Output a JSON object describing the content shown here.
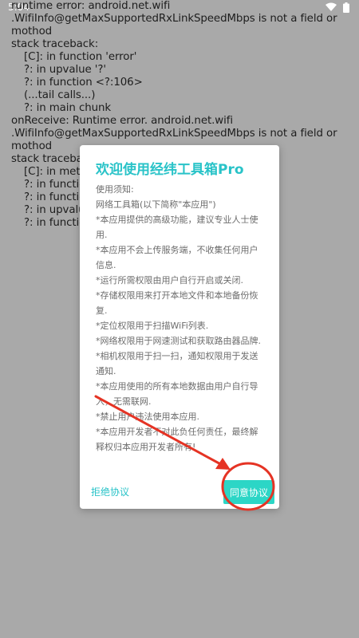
{
  "status_bar": {
    "time": "5:04"
  },
  "log_lines": [
    {
      "text": "runtime error: android.net.wifi",
      "indent": false
    },
    {
      "text": ".WifiInfo@getMaxSupportedRxLinkSpeedMbps is not a field or",
      "indent": false
    },
    {
      "text": "mothod",
      "indent": false
    },
    {
      "text": "stack traceback:",
      "indent": false
    },
    {
      "text": "[C]: in function 'error'",
      "indent": true
    },
    {
      "text": "?: in upvalue '?'",
      "indent": true
    },
    {
      "text": "?: in function <?:106>",
      "indent": true
    },
    {
      "text": "(...tail calls...)",
      "indent": true
    },
    {
      "text": "?: in main chunk",
      "indent": true
    },
    {
      "text": "onReceive: Runtime error. android.net.wifi",
      "indent": false
    },
    {
      "text": ".WifiInfo@getMaxSupportedRxLinkSpeedMbps is not a field or",
      "indent": false
    },
    {
      "text": "mothod",
      "indent": false
    },
    {
      "text": "stack traceback:",
      "indent": false
    },
    {
      "text": "[C]: in metamethod 'index'",
      "indent": true
    },
    {
      "text": "?: in function",
      "indent": true
    },
    {
      "text": "?: in function",
      "indent": true
    },
    {
      "text": "?: in upvalue",
      "indent": true
    },
    {
      "text": "?: in function",
      "indent": true
    }
  ],
  "dialog": {
    "title": "欢迎使用经纬工具箱Pro",
    "body": [
      "使用须知:",
      "网络工具箱(以下简称\"本应用\")",
      "*本应用提供的高级功能，建议专业人士使用.",
      "*本应用不会上传服务端，不收集任何用户信息.",
      "*运行所需权限由用户自行开启或关闭.",
      "*存储权限用来打开本地文件和本地备份恢复.",
      "*定位权限用于扫描WiFi列表.",
      "*网络权限用于网速测试和获取路由器品牌.",
      "*相机权限用于扫一扫，通知权限用于发送通知.",
      "*本应用使用的所有本地数据由用户自行导入，无需联网.",
      "*禁止用户违法使用本应用.",
      "*本应用开发者不对此负任何责任，最终解释权归本应用开发者所有!"
    ],
    "decline_label": "拒绝协议",
    "accept_label": "同意协议"
  },
  "colors": {
    "accent": "#29c3c8",
    "accept_button": "#2cd6c6",
    "annotation": "#e53324",
    "overlay": "#a9a9a9"
  }
}
